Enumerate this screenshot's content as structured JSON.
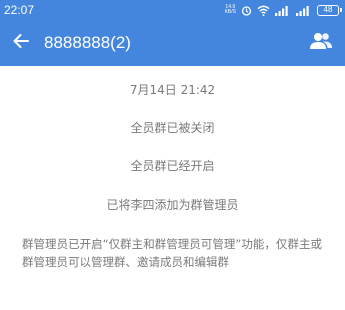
{
  "status_bar": {
    "time": "22:07",
    "net_speed_value": "14.9",
    "net_speed_unit": "KB/S",
    "battery": "48",
    "icons": [
      "alarm-clock-icon",
      "wifi-icon",
      "signal-icon",
      "signal-icon",
      "battery-icon"
    ]
  },
  "header": {
    "title": "8888888(2)",
    "back_icon": "arrow-left-icon",
    "members_icon": "group-members-icon"
  },
  "messages": [
    {
      "text": "7月14日  21:42"
    },
    {
      "text": "全员群已被关闭"
    },
    {
      "text": "全员群已经开启"
    },
    {
      "text": "已将李四添加为群管理员"
    },
    {
      "text": "群管理员已开启“仅群主和群管理员可管理”功能，仅群主或群管理员可以管理群、邀请成员和编辑群"
    }
  ],
  "colors": {
    "primary": "#4486dd",
    "system_text": "#7a7a7a",
    "background": "#ffffff"
  }
}
